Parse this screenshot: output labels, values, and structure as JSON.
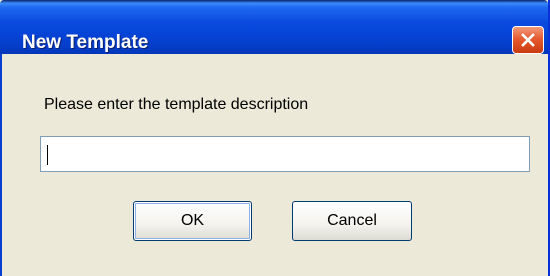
{
  "dialog": {
    "title": "New Template",
    "prompt": "Please enter the template description",
    "input": {
      "value": ""
    },
    "buttons": {
      "ok_label": "OK",
      "cancel_label": "Cancel"
    },
    "close_icon": "close-icon"
  },
  "colors": {
    "titlebar_blue": "#0b4be0",
    "close_red": "#e55b2f",
    "dialog_background": "#ece9d8"
  }
}
